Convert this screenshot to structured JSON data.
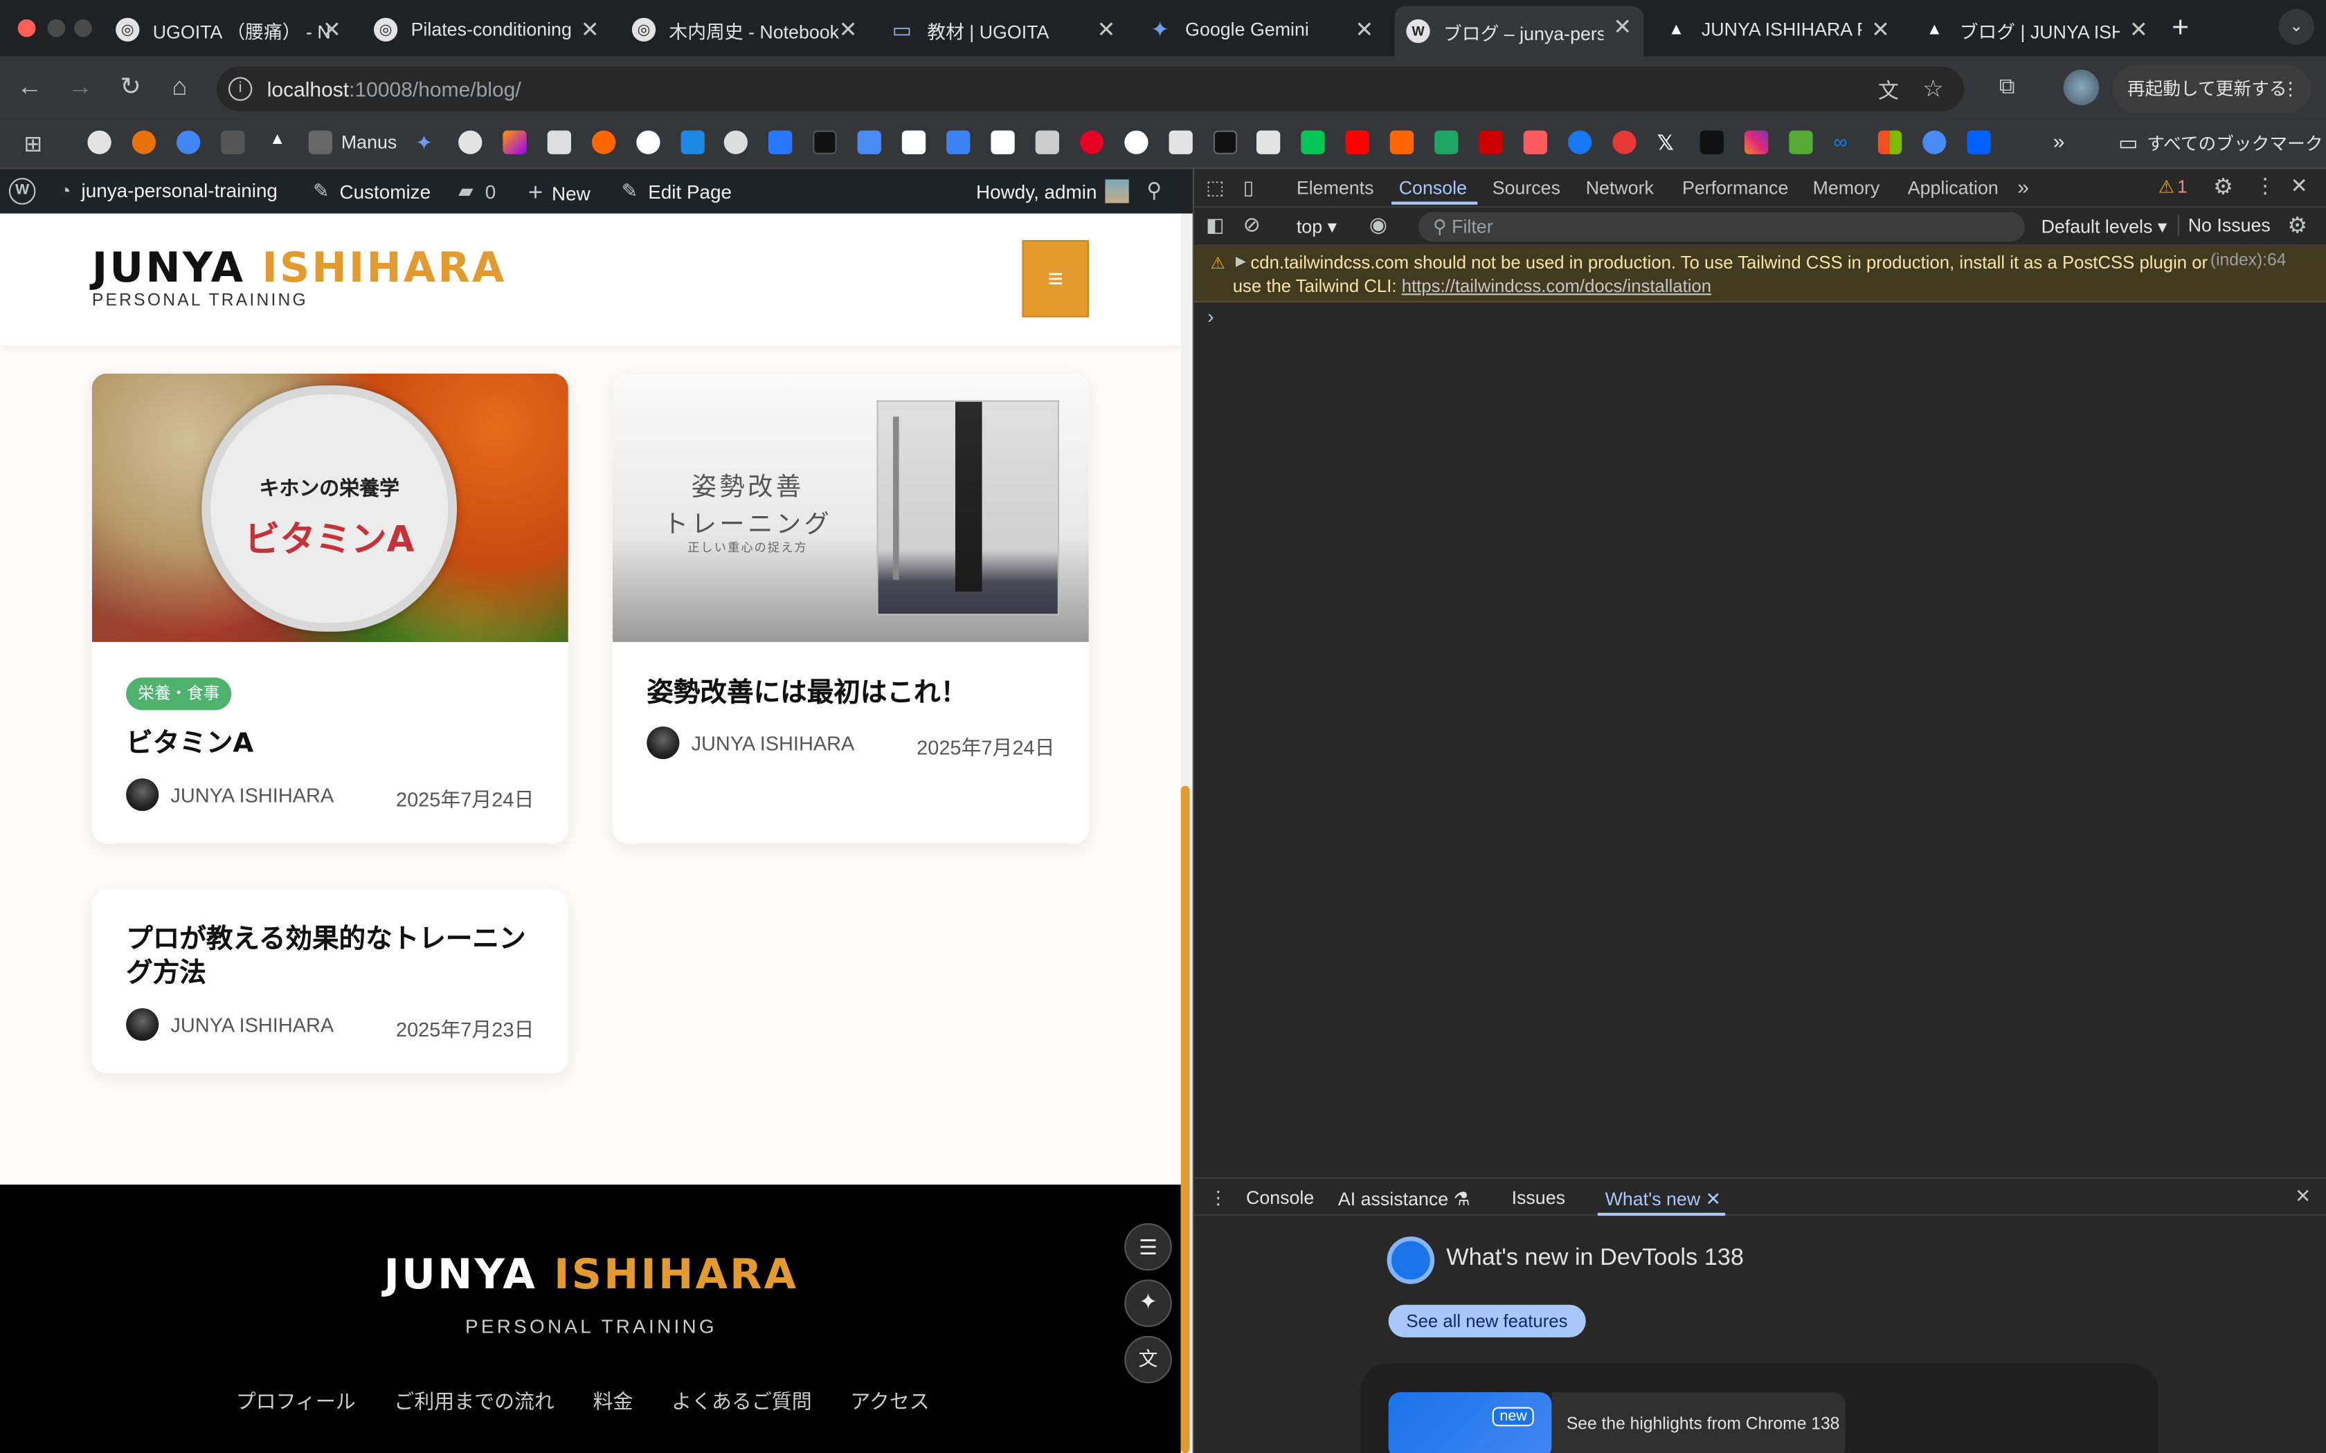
{
  "tabs": [
    {
      "title": "UGOITA （腰痛） - N",
      "icon": "openai-icon"
    },
    {
      "title": "Pilates-conditioning",
      "icon": "openai-icon"
    },
    {
      "title": "木内周史 - Notebook",
      "icon": "openai-icon"
    },
    {
      "title": "教材 | UGOITA",
      "icon": "laptop-icon"
    },
    {
      "title": "Google Gemini",
      "icon": "gemini-icon"
    },
    {
      "title": "ブログ – junya-perso",
      "icon": "wordpress-icon"
    },
    {
      "title": "JUNYA ISHIHARA PE",
      "icon": "triangle-icon"
    },
    {
      "title": "ブログ | JUNYA ISHIH",
      "icon": "triangle-icon"
    }
  ],
  "address": {
    "host": "localhost",
    "rest": ":10008/home/blog/"
  },
  "toolbar": {
    "relaunch": "再起動して更新する"
  },
  "bookmarks": {
    "manus": "Manus",
    "all": "すべてのブックマーク"
  },
  "wp": {
    "site": "junya-personal-training",
    "customize": "Customize",
    "comments": "0",
    "new": "New",
    "edit": "Edit Page",
    "howdy": "Howdy, admin"
  },
  "site": {
    "logo_first": "JUNYA",
    "logo_second": "ISHIHARA",
    "tagline": "PERSONAL TRAINING"
  },
  "posts": [
    {
      "category": "栄養・食事",
      "title": "ビタミンA",
      "author": "JUNYA ISHIHARA",
      "date": "2025年7月24日",
      "img_line1": "キホンの栄養学",
      "img_line2": "ビタミンA"
    },
    {
      "title": "姿勢改善には最初はこれ！",
      "author": "JUNYA ISHIHARA",
      "date": "2025年7月24日",
      "img_line1": "姿勢改善",
      "img_line2": "トレーニング",
      "img_line3": "正しい重心の捉え方"
    },
    {
      "title": "プロが教える効果的なトレーニング方法",
      "author": "JUNYA ISHIHARA",
      "date": "2025年7月23日"
    }
  ],
  "footer": {
    "logo_first": "JUNYA",
    "logo_second": "ISHIHARA",
    "tagline": "PERSONAL TRAINING",
    "nav": [
      "プロフィール",
      "ご利用までの流れ",
      "料金",
      "よくあるご質問",
      "アクセス"
    ]
  },
  "devtools": {
    "tabs": [
      "Elements",
      "Console",
      "Sources",
      "Network",
      "Performance",
      "Memory",
      "Application"
    ],
    "active": "Console",
    "warnings": "1",
    "context": "top",
    "filter": "Filter",
    "levels": "Default levels",
    "issues": "No Issues",
    "message": "cdn.tailwindcss.com should not be used in production. To use Tailwind CSS in production, install it as a PostCSS plugin or use the Tailwind CLI:",
    "link": "https://tailwindcss.com/docs/installation",
    "source": "(index):64",
    "drawer_tabs": [
      "Console",
      "AI assistance",
      "Issues",
      "What's new"
    ],
    "whatsnew_title": "What's new in DevTools 138",
    "see_all": "See all new features",
    "badge": "new",
    "highlights": "See the highlights from Chrome 138"
  },
  "colors": {
    "accent": "#e39a2e",
    "category": "#4fb36f",
    "wpbar": "#1d2327",
    "devtools": "#282828"
  }
}
